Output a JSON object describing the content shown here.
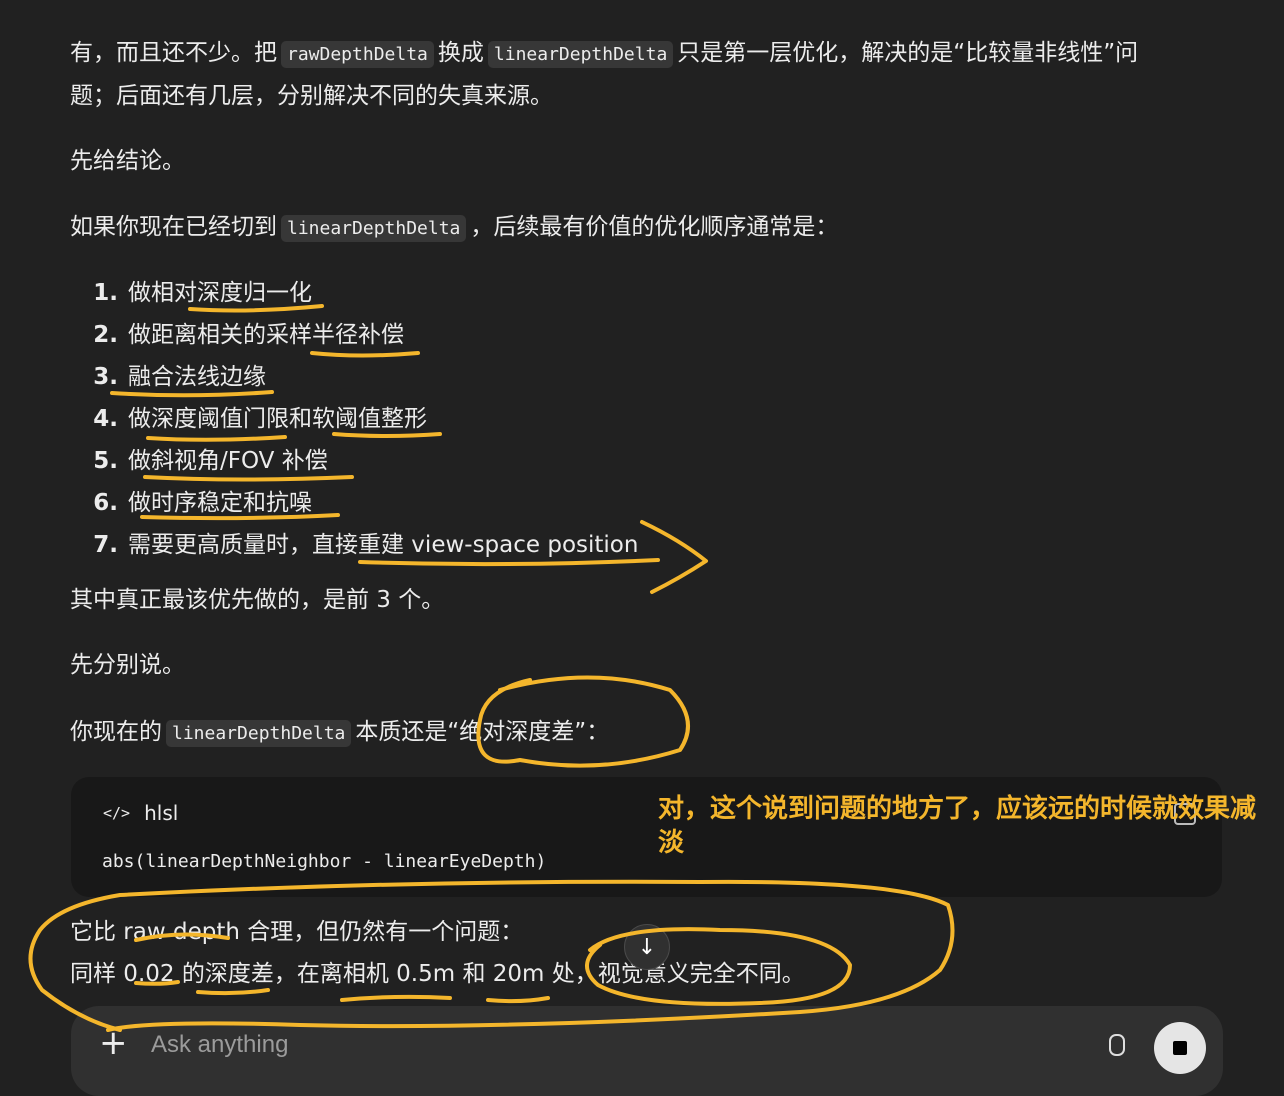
{
  "content": {
    "para1": {
      "t1": "有，而且还不少。把",
      "code1": "rawDepthDelta",
      "t2": "换成",
      "code2": "linearDepthDelta",
      "t3": "只是第一层优化，解决的是“比较量非线性”问",
      "line2": "题；后面还有几层，分别解决不同的失真来源。"
    },
    "conclusion": "先给结论。",
    "para2": {
      "t1": "如果你现在已经切到",
      "code": "linearDepthDelta",
      "t2": "，后续最有价值的优化顺序通常是："
    },
    "steps": [
      {
        "num": "1.",
        "label": "做相对深度归一化"
      },
      {
        "num": "2.",
        "label": "做距离相关的采样半径补偿"
      },
      {
        "num": "3.",
        "label": "融合法线边缘"
      },
      {
        "num": "4.",
        "label": "做深度阈值门限和软阈值整形"
      },
      {
        "num": "5.",
        "label": "做斜视角/FOV 补偿"
      },
      {
        "num": "6.",
        "label": "做时序稳定和抗噪"
      },
      {
        "num": "7.",
        "label": "需要更高质量时，直接重建 view-space position"
      }
    ],
    "priority": "其中真正最该优先做的，是前 3 个。",
    "separately": "先分别说。",
    "para3": {
      "t1": "你现在的",
      "code": "linearDepthDelta",
      "t2": "本质还是“绝对深度差”："
    },
    "codeblock": {
      "lang": "hlsl",
      "lang_icon": "</>",
      "code": "abs(linearDepthNeighbor - linearEyeDepth)"
    },
    "para4": {
      "line1": "它比 raw depth 合理，但仍然有一个问题：",
      "line2": "同样 0.02 的深度差，在离相机 0.5m 和 20m 处，视觉意义完全不同。"
    }
  },
  "annotation": {
    "note": "对，这个说到问题的地方了，应该远的时候就效果减淡",
    "color": "#f4b62c"
  },
  "composer": {
    "placeholder": "Ask anything",
    "plus_icon": "+"
  },
  "scroll_button": {
    "icon": "↓"
  },
  "colors": {
    "background": "#212121",
    "text": "#ececec",
    "code_bg": "#373737",
    "codeblock_bg": "#181818"
  }
}
